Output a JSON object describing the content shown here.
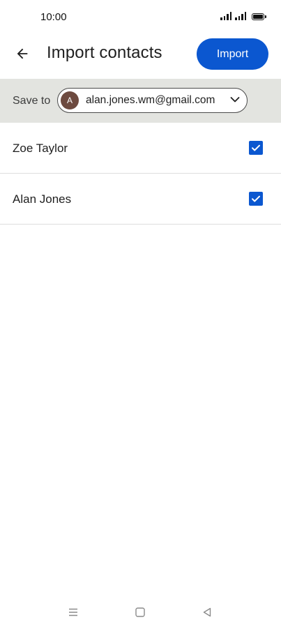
{
  "status_bar": {
    "time": "10:00"
  },
  "app_bar": {
    "back_icon": "arrow-back-icon",
    "title": "Import contacts",
    "import_label": "Import"
  },
  "save_to": {
    "label": "Save to",
    "account": {
      "avatar_letter": "A",
      "avatar_color": "#6d4a3f",
      "email": "alan.jones.wm@gmail.com"
    }
  },
  "contacts": [
    {
      "name": "Zoe Taylor",
      "checked": true
    },
    {
      "name": "Alan Jones",
      "checked": true
    }
  ],
  "colors": {
    "accent": "#0b57d0",
    "save_bar_bg": "#e3e4e0"
  },
  "nav_bar": {
    "icons": [
      "menu-icon",
      "home-square-icon",
      "back-triangle-icon"
    ]
  }
}
